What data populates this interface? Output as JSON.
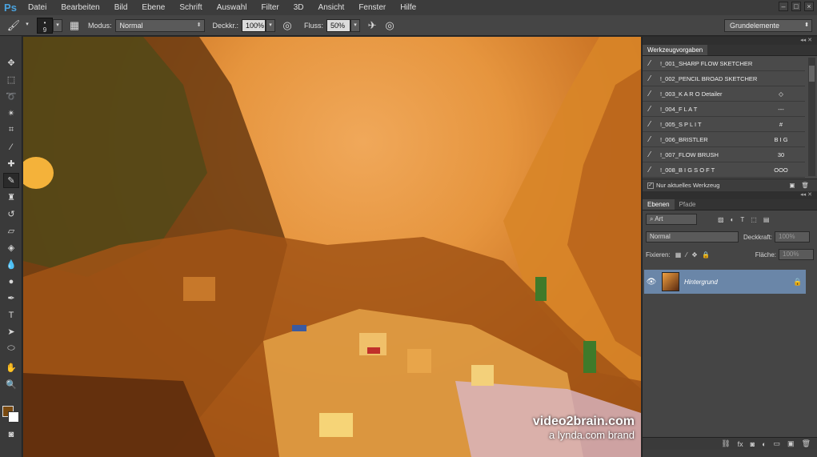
{
  "app": {
    "logo": "Ps"
  },
  "menu": [
    "Datei",
    "Bearbeiten",
    "Bild",
    "Ebene",
    "Schrift",
    "Auswahl",
    "Filter",
    "3D",
    "Ansicht",
    "Fenster",
    "Hilfe"
  ],
  "options": {
    "brush_size": "9",
    "mode_label": "Modus:",
    "mode_value": "Normal",
    "opacity_label": "Deckkr.:",
    "opacity_value": "100%",
    "flow_label": "Fluss:",
    "flow_value": "50%",
    "workspace": "Grundelemente"
  },
  "tool_presets": {
    "tab": "Werkzeugvorgaben",
    "items": [
      {
        "name": "!_001_SHARP FLOW SKETCHER",
        "extra": ""
      },
      {
        "name": "!_002_PENCIL BROAD SKETCHER",
        "extra": ""
      },
      {
        "name": "!_003_K A R O  Detailer",
        "extra": "◇"
      },
      {
        "name": "!_004_F L A T",
        "extra": "---"
      },
      {
        "name": "!_005_S P L I T",
        "extra": "#"
      },
      {
        "name": "!_006_BRISTLER",
        "extra": "B I G"
      },
      {
        "name": "!_007_FLOW BRUSH",
        "extra": "30"
      },
      {
        "name": "!_008_B I G  S O F T",
        "extra": "OOO"
      }
    ],
    "current_only_label": "Nur aktuelles Werkzeug"
  },
  "layers": {
    "tabs": [
      "Ebenen",
      "Pfade"
    ],
    "filter_label": "Art",
    "blend_mode": "Normal",
    "opacity_label": "Deckkraft:",
    "opacity_value": "100%",
    "lock_label": "Fixieren:",
    "fill_label": "Fläche:",
    "fill_value": "100%",
    "layer_name": "Hintergrund"
  },
  "watermark": {
    "line1": "video2brain.com",
    "line2": "a lynda.com brand"
  },
  "colors": {
    "foreground": "#7a4a10",
    "background": "#ffffff",
    "selected_layer": "#6a86a8"
  }
}
